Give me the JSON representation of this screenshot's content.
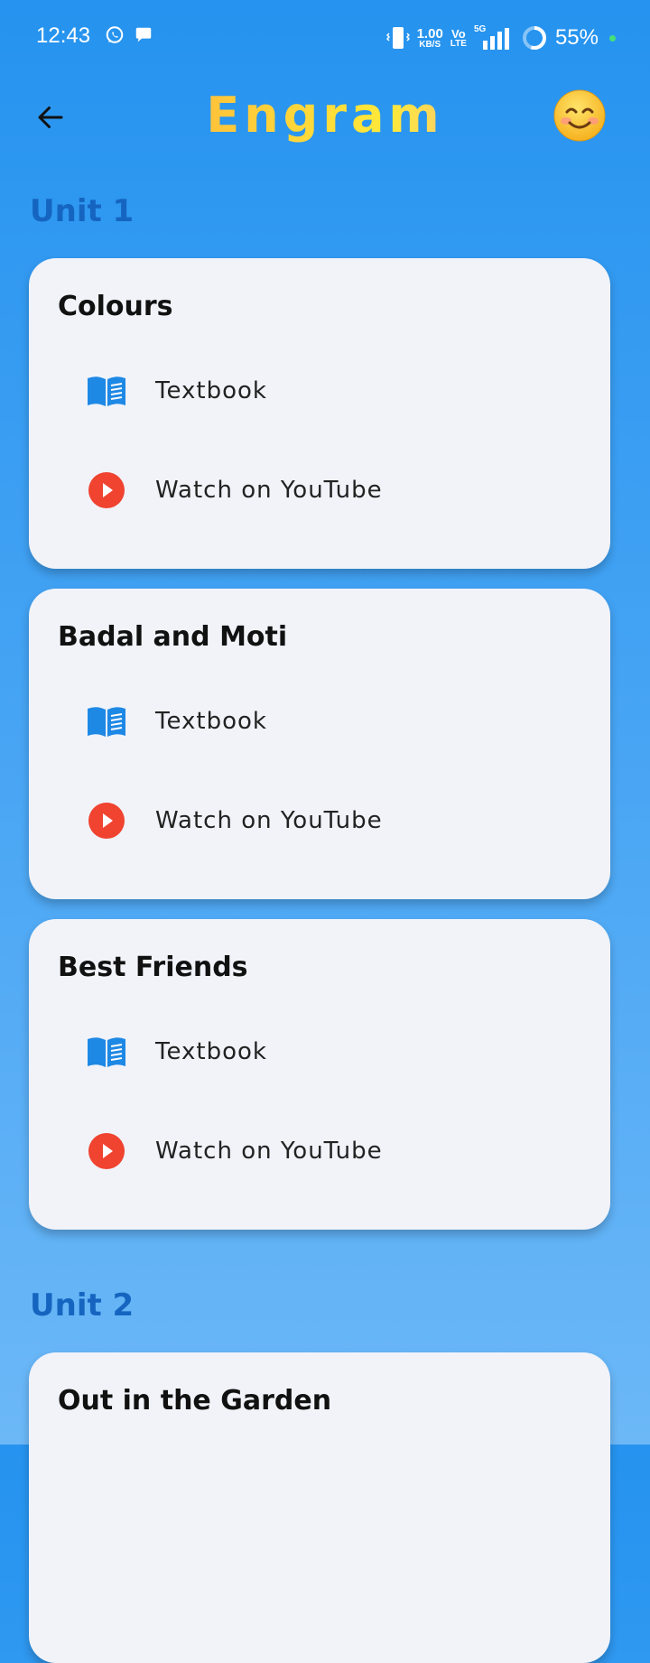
{
  "status_bar": {
    "time": "12:43",
    "net_speed_value": "1.00",
    "net_speed_unit": "KB/S",
    "volte_top": "Vo",
    "volte_bottom": "LTE",
    "network_type": "5G",
    "battery": "55%"
  },
  "app_bar": {
    "title": "Engram",
    "back_icon": "arrow-left-icon",
    "profile_icon": "smiling-face-icon"
  },
  "units": [
    {
      "heading": "Unit 1",
      "chapters": [
        {
          "title": "Colours",
          "textbook_label": "Textbook",
          "youtube_label": "Watch on YouTube"
        },
        {
          "title": "Badal and Moti",
          "textbook_label": "Textbook",
          "youtube_label": "Watch on YouTube"
        },
        {
          "title": "Best Friends",
          "textbook_label": "Textbook",
          "youtube_label": "Watch on YouTube"
        }
      ]
    },
    {
      "heading": "Unit 2",
      "chapters": [
        {
          "title": "Out in the Garden"
        }
      ]
    }
  ],
  "colors": {
    "background_top": "#2593ef",
    "unit_heading": "#1565c0",
    "card_bg": "#f1f3f9",
    "book_icon": "#1e88e5",
    "youtube_icon": "#f04330"
  }
}
